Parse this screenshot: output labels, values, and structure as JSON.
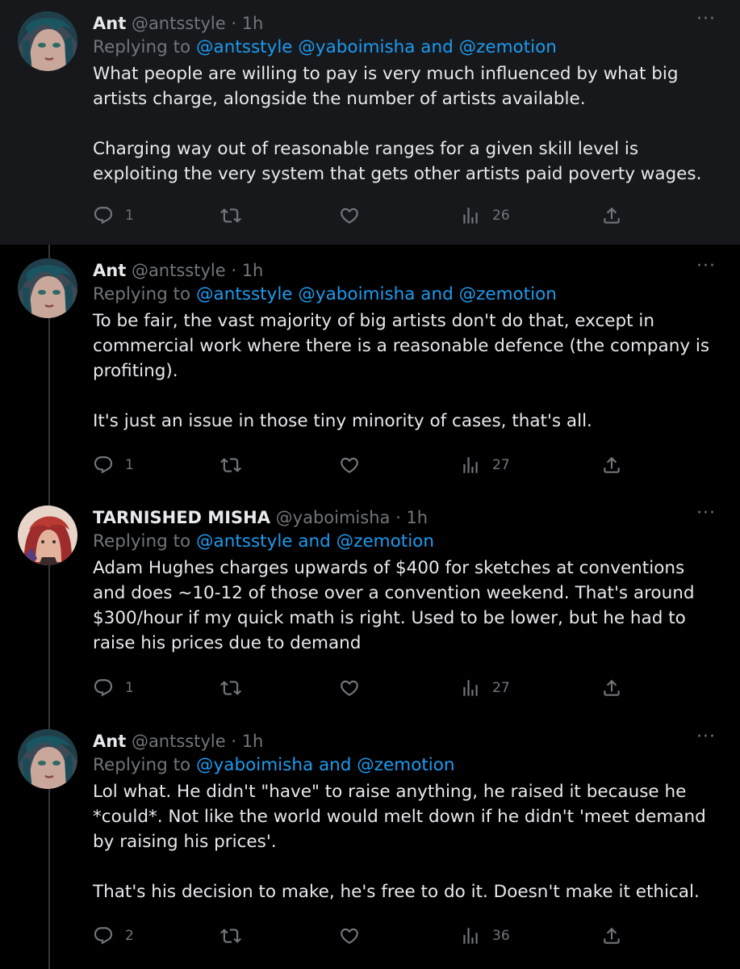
{
  "tweets": [
    {
      "name": "Ant",
      "handle": "@antsstyle",
      "time": "· 1h",
      "replying_to_prefix": "Replying to ",
      "replying_to_mentions": "@antsstyle @yaboimisha and @zemotion",
      "text": "What people are willing to pay is very much influenced by what big artists charge, alongside the number of artists available.\n\nCharging way out of reasonable ranges for a given skill level is exploiting the very system that gets other artists paid poverty wages.",
      "replies": "1",
      "retweets": "",
      "likes": "",
      "views": "26",
      "more": "···"
    },
    {
      "name": "Ant",
      "handle": "@antsstyle",
      "time": "· 1h",
      "replying_to_prefix": "Replying to ",
      "replying_to_mentions": "@antsstyle @yaboimisha and @zemotion",
      "text": "To be fair, the vast majority of big artists don't do that, except in commercial work where there is a reasonable defence (the company is profiting).\n\nIt's just an issue in those tiny minority of cases, that's all.",
      "replies": "1",
      "retweets": "",
      "likes": "",
      "views": "27",
      "more": "···"
    },
    {
      "name": "TARNISHED MISHA",
      "handle": "@yaboimisha",
      "time": "· 1h",
      "replying_to_prefix": "Replying to ",
      "replying_to_mentions": "@antsstyle and @zemotion",
      "text": "Adam Hughes charges upwards of $400 for sketches at conventions and does ~10-12 of those over a convention weekend. That's around $300/hour if my quick math is right. Used to be lower, but he had to raise his prices due to demand",
      "replies": "1",
      "retweets": "",
      "likes": "",
      "views": "27",
      "more": "···"
    },
    {
      "name": "Ant",
      "handle": "@antsstyle",
      "time": "· 1h",
      "replying_to_prefix": "Replying to ",
      "replying_to_mentions": "@yaboimisha and @zemotion",
      "text": "Lol what. He didn't \"have\" to raise anything, he raised it because he *could*. Not like the world would melt down if he didn't 'meet demand by raising his prices'.\n\nThat's his decision to make, he's free to do it. Doesn't make it ethical.",
      "replies": "2",
      "retweets": "",
      "likes": "",
      "views": "36",
      "more": "···"
    }
  ],
  "icons": {
    "reply": "reply-icon",
    "retweet": "retweet-icon",
    "like": "like-icon",
    "views": "views-icon",
    "share": "share-icon",
    "more": "more-icon"
  },
  "colors": {
    "background": "#000000",
    "highlight": "#16181c",
    "text": "#e7e9ea",
    "muted": "#71767b",
    "link": "#1d9bf0"
  }
}
